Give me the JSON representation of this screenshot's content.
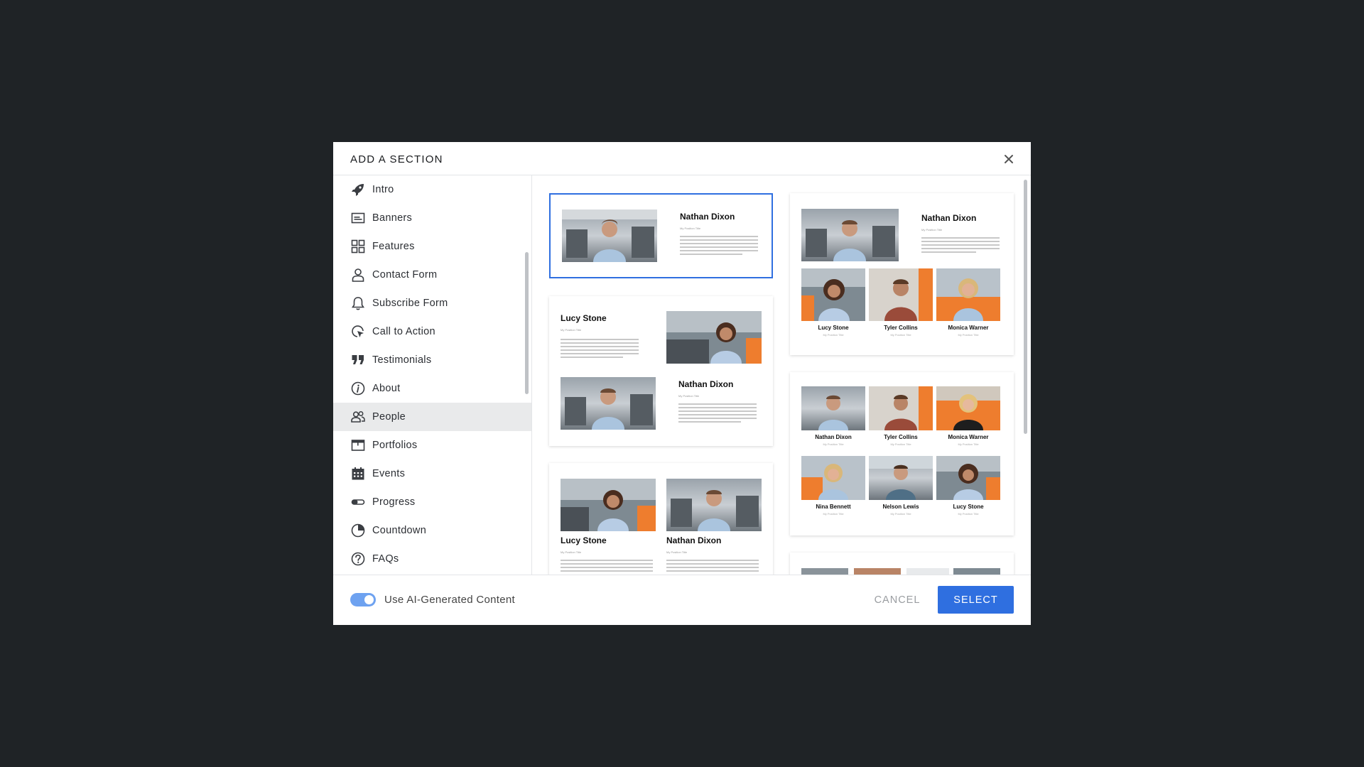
{
  "modal": {
    "title": "ADD A SECTION"
  },
  "sidebar": {
    "items": [
      {
        "label": "Intro",
        "icon": "rocket-icon"
      },
      {
        "label": "Banners",
        "icon": "banner-icon"
      },
      {
        "label": "Features",
        "icon": "grid-icon"
      },
      {
        "label": "Contact Form",
        "icon": "person-icon"
      },
      {
        "label": "Subscribe Form",
        "icon": "bell-icon"
      },
      {
        "label": "Call to Action",
        "icon": "cursor-click-icon"
      },
      {
        "label": "Testimonials",
        "icon": "quote-icon"
      },
      {
        "label": "About",
        "icon": "info-icon"
      },
      {
        "label": "People",
        "icon": "people-icon"
      },
      {
        "label": "Portfolios",
        "icon": "portfolio-icon"
      },
      {
        "label": "Events",
        "icon": "calendar-icon"
      },
      {
        "label": "Progress",
        "icon": "progress-icon"
      },
      {
        "label": "Countdown",
        "icon": "clock-icon"
      },
      {
        "label": "FAQs",
        "icon": "question-icon"
      }
    ],
    "active": "People"
  },
  "cards": {
    "card1": {
      "name": "Nathan Dixon",
      "position": "My Position Title"
    },
    "card2": {
      "top": {
        "name": "Lucy Stone",
        "position": "My Position Title"
      },
      "bottom": {
        "name": "Nathan Dixon",
        "position": "My Position Title"
      }
    },
    "card3": {
      "left": {
        "name": "Lucy Stone",
        "position": "My Position Title"
      },
      "right": {
        "name": "Nathan Dixon",
        "position": "My Position Title"
      }
    },
    "card4": {
      "main": {
        "name": "Nathan Dixon",
        "position": "My Position Title"
      },
      "people": [
        {
          "name": "Lucy Stone",
          "position": "My Position Title"
        },
        {
          "name": "Tyler Collins",
          "position": "My Position Title"
        },
        {
          "name": "Monica Warner",
          "position": "My Position Title"
        }
      ]
    },
    "card5": {
      "people": [
        {
          "name": "Nathan Dixon",
          "position": "My Position Title"
        },
        {
          "name": "Tyler Collins",
          "position": "My Position Title"
        },
        {
          "name": "Monica Warner",
          "position": "My Position Title"
        },
        {
          "name": "Nina Bennett",
          "position": "My Position Title"
        },
        {
          "name": "Nelson Lewis",
          "position": "My Position Title"
        },
        {
          "name": "Lucy Stone",
          "position": "My Position Title"
        }
      ]
    }
  },
  "footer": {
    "toggle_label": "Use AI-Generated Content",
    "toggle_on": true,
    "cancel_label": "CANCEL",
    "select_label": "SELECT"
  },
  "colors": {
    "accent": "#2f6fe0",
    "toggle": "#6ea2f0",
    "backdrop": "#1f2326"
  }
}
